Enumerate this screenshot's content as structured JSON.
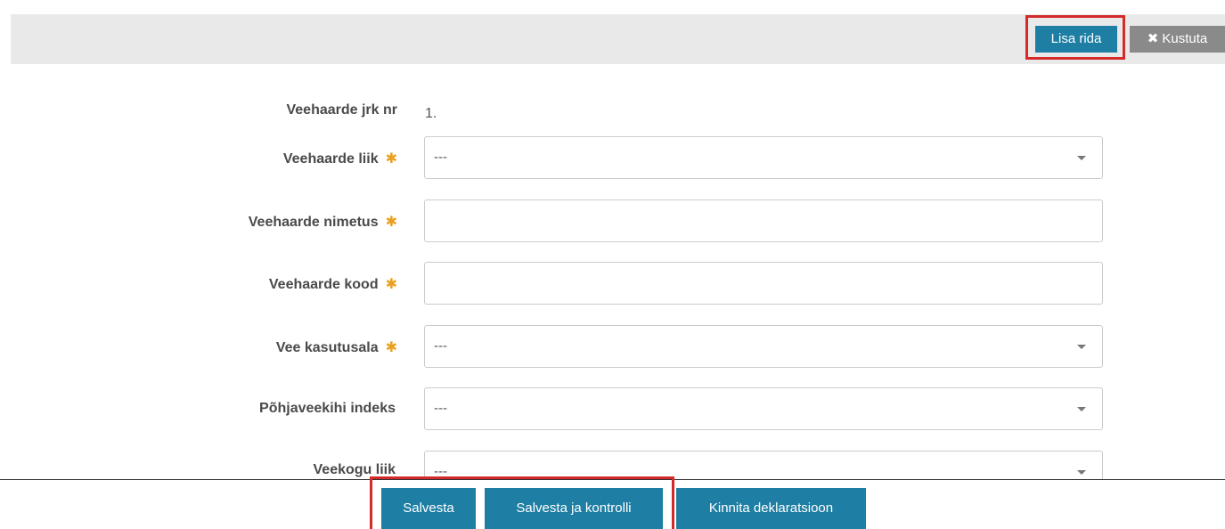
{
  "toolbar": {
    "add_row_label": "Lisa rida",
    "delete_label": "Kustuta",
    "delete_icon": "close-icon"
  },
  "form": {
    "order_number": {
      "label": "Veehaarde jrk nr",
      "value": "1."
    },
    "intake_type": {
      "label": "Veehaarde liik",
      "required": true,
      "value": "---"
    },
    "intake_name": {
      "label": "Veehaarde nimetus",
      "required": true,
      "value": ""
    },
    "intake_code": {
      "label": "Veehaarde kood",
      "required": true,
      "value": ""
    },
    "water_use_area": {
      "label": "Vee kasutusala",
      "required": true,
      "value": "---"
    },
    "aquifer_index": {
      "label": "Põhjaveekihi indeks",
      "required": false,
      "value": "---"
    },
    "water_body_type": {
      "label": "Veekogu liik",
      "required": false,
      "value": "---"
    }
  },
  "footer": {
    "save_label": "Salvesta",
    "save_check_label": "Salvesta ja kontrolli",
    "confirm_label": "Kinnita deklaratsioon"
  },
  "colors": {
    "primary": "#1e7ea3",
    "delete": "#8a8a8a",
    "highlight": "#d42a2a",
    "required_star": "#e8a020",
    "toolbar_bg": "#e9e9e9"
  }
}
